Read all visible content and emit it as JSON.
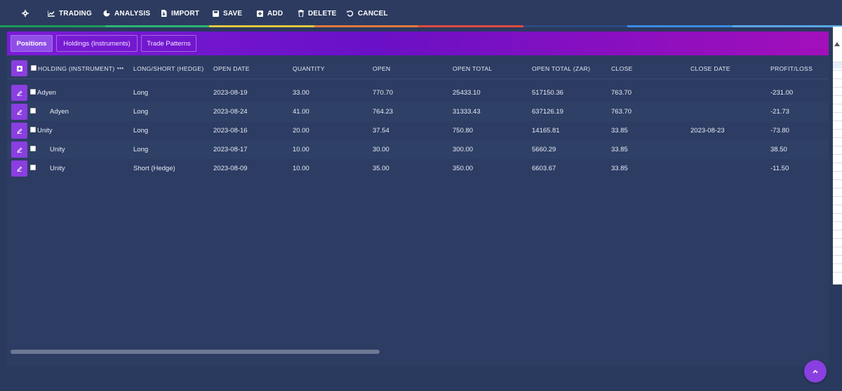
{
  "toolbar": {
    "items": [
      {
        "icon": "gear-icon",
        "label": ""
      },
      {
        "icon": "chart-line-icon",
        "label": "TRADING"
      },
      {
        "icon": "pie-chart-icon",
        "label": "ANALYSIS"
      },
      {
        "icon": "import-icon",
        "label": "IMPORT"
      },
      {
        "icon": "save-icon",
        "label": "SAVE"
      },
      {
        "icon": "plus-square-icon",
        "label": "ADD"
      },
      {
        "icon": "trash-icon",
        "label": "DELETE"
      },
      {
        "icon": "undo-icon",
        "label": "CANCEL"
      }
    ],
    "stripe_colors": [
      "#1d9a5a",
      "#2bb673",
      "#e2c840",
      "#e07a3f",
      "#e0493f",
      "#2c4a82",
      "#3a8de0",
      "#5aa6e6"
    ]
  },
  "tabs": [
    {
      "label": "Positions",
      "active": true
    },
    {
      "label": "Holdings (Instruments)",
      "active": false
    },
    {
      "label": "Trade Patterns",
      "active": false
    }
  ],
  "table": {
    "headers": {
      "holding": "HOLDING (INSTRUMENT)",
      "more": "•••",
      "long_short": "LONG/SHORT (HEDGE)",
      "open_date": "OPEN DATE",
      "quantity": "QUANTITY",
      "open": "OPEN",
      "open_total": "OPEN TOTAL",
      "open_total_zar": "OPEN TOTAL (ZAR)",
      "close": "CLOSE",
      "close_date": "CLOSE DATE",
      "profit_loss": "PROFIT/LOSS"
    },
    "rows": [
      {
        "holding": "Adyen",
        "indent": false,
        "long_short": "Long",
        "open_date": "2023-08-19",
        "quantity": "33.00",
        "open": "770.70",
        "open_total": "25433.10",
        "open_total_zar": "517150.36",
        "close": "763.70",
        "close_date": "",
        "profit_loss": "-231.00"
      },
      {
        "holding": "Adyen",
        "indent": true,
        "long_short": "Long",
        "open_date": "2023-08-24",
        "quantity": "41.00",
        "open": "764.23",
        "open_total": "31333.43",
        "open_total_zar": "637126.19",
        "close": "763.70",
        "close_date": "",
        "profit_loss": "-21.73"
      },
      {
        "holding": "Unity",
        "indent": false,
        "long_short": "Long",
        "open_date": "2023-08-16",
        "quantity": "20.00",
        "open": "37.54",
        "open_total": "750.80",
        "open_total_zar": "14165.81",
        "close": "33.85",
        "close_date": "2023-08-23",
        "profit_loss": "-73.80"
      },
      {
        "holding": "Unity",
        "indent": true,
        "long_short": "Long",
        "open_date": "2023-08-17",
        "quantity": "10.00",
        "open": "30.00",
        "open_total": "300.00",
        "open_total_zar": "5660.29",
        "close": "33.85",
        "close_date": "",
        "profit_loss": "38.50"
      },
      {
        "holding": "Unity",
        "indent": true,
        "long_short": "Short (Hedge)",
        "open_date": "2023-08-09",
        "quantity": "10.00",
        "open": "35.00",
        "open_total": "350.00",
        "open_total_zar": "6603.67",
        "close": "33.85",
        "close_date": "",
        "profit_loss": "-11.50"
      }
    ]
  },
  "colors": {
    "accent": "#8a3fe0",
    "background": "#2a3a5e",
    "tab_gradient_start": "#7a1dd6",
    "tab_gradient_end": "#a20fbb"
  },
  "scroll_to_top_icon": "chevron-up-icon"
}
